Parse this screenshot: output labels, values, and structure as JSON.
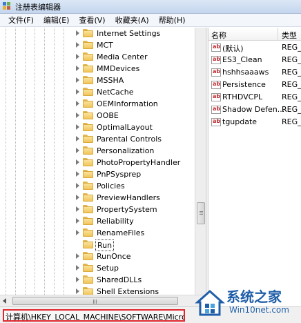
{
  "window": {
    "title": "注册表编辑器"
  },
  "menu": [
    "文件(F)",
    "编辑(E)",
    "查看(V)",
    "收藏夹(A)",
    "帮助(H)"
  ],
  "tree": {
    "items": [
      {
        "label": "Internet Settings"
      },
      {
        "label": "MCT"
      },
      {
        "label": "Media Center"
      },
      {
        "label": "MMDevices"
      },
      {
        "label": "MSSHA"
      },
      {
        "label": "NetCache"
      },
      {
        "label": "OEMInformation"
      },
      {
        "label": "OOBE"
      },
      {
        "label": "OptimalLayout"
      },
      {
        "label": "Parental Controls"
      },
      {
        "label": "Personalization"
      },
      {
        "label": "PhotoPropertyHandler"
      },
      {
        "label": "PnPSysprep"
      },
      {
        "label": "Policies"
      },
      {
        "label": "PreviewHandlers"
      },
      {
        "label": "PropertySystem"
      },
      {
        "label": "Reliability"
      },
      {
        "label": "RenameFiles"
      },
      {
        "label": "Run",
        "selected": true
      },
      {
        "label": "RunOnce"
      },
      {
        "label": "Setup"
      },
      {
        "label": "SharedDLLs"
      },
      {
        "label": "Shell Extensions"
      }
    ]
  },
  "values_list": {
    "headers": {
      "name": "名称",
      "type": "类型"
    },
    "rows": [
      {
        "name": "(默认)",
        "type": "REG_S"
      },
      {
        "name": "ES3_Clean",
        "type": "REG_S"
      },
      {
        "name": "hshhsaaaws",
        "type": "REG_S"
      },
      {
        "name": "Persistence",
        "type": "REG_S"
      },
      {
        "name": "RTHDVCPL",
        "type": "REG_S"
      },
      {
        "name": "Shadow Defen...",
        "type": "REG_S"
      },
      {
        "name": "tgupdate",
        "type": "REG_S"
      }
    ]
  },
  "status": {
    "path": "计算机\\HKEY_LOCAL_MACHINE\\SOFTWARE\\Microsoft\\Windows\\CurrentVersion\\Run"
  },
  "watermark": {
    "title": "系统之家",
    "subtitle": "Win10net.com"
  },
  "colors": {
    "highlight_border": "#e0262d",
    "watermark": "#1f5ea8"
  }
}
